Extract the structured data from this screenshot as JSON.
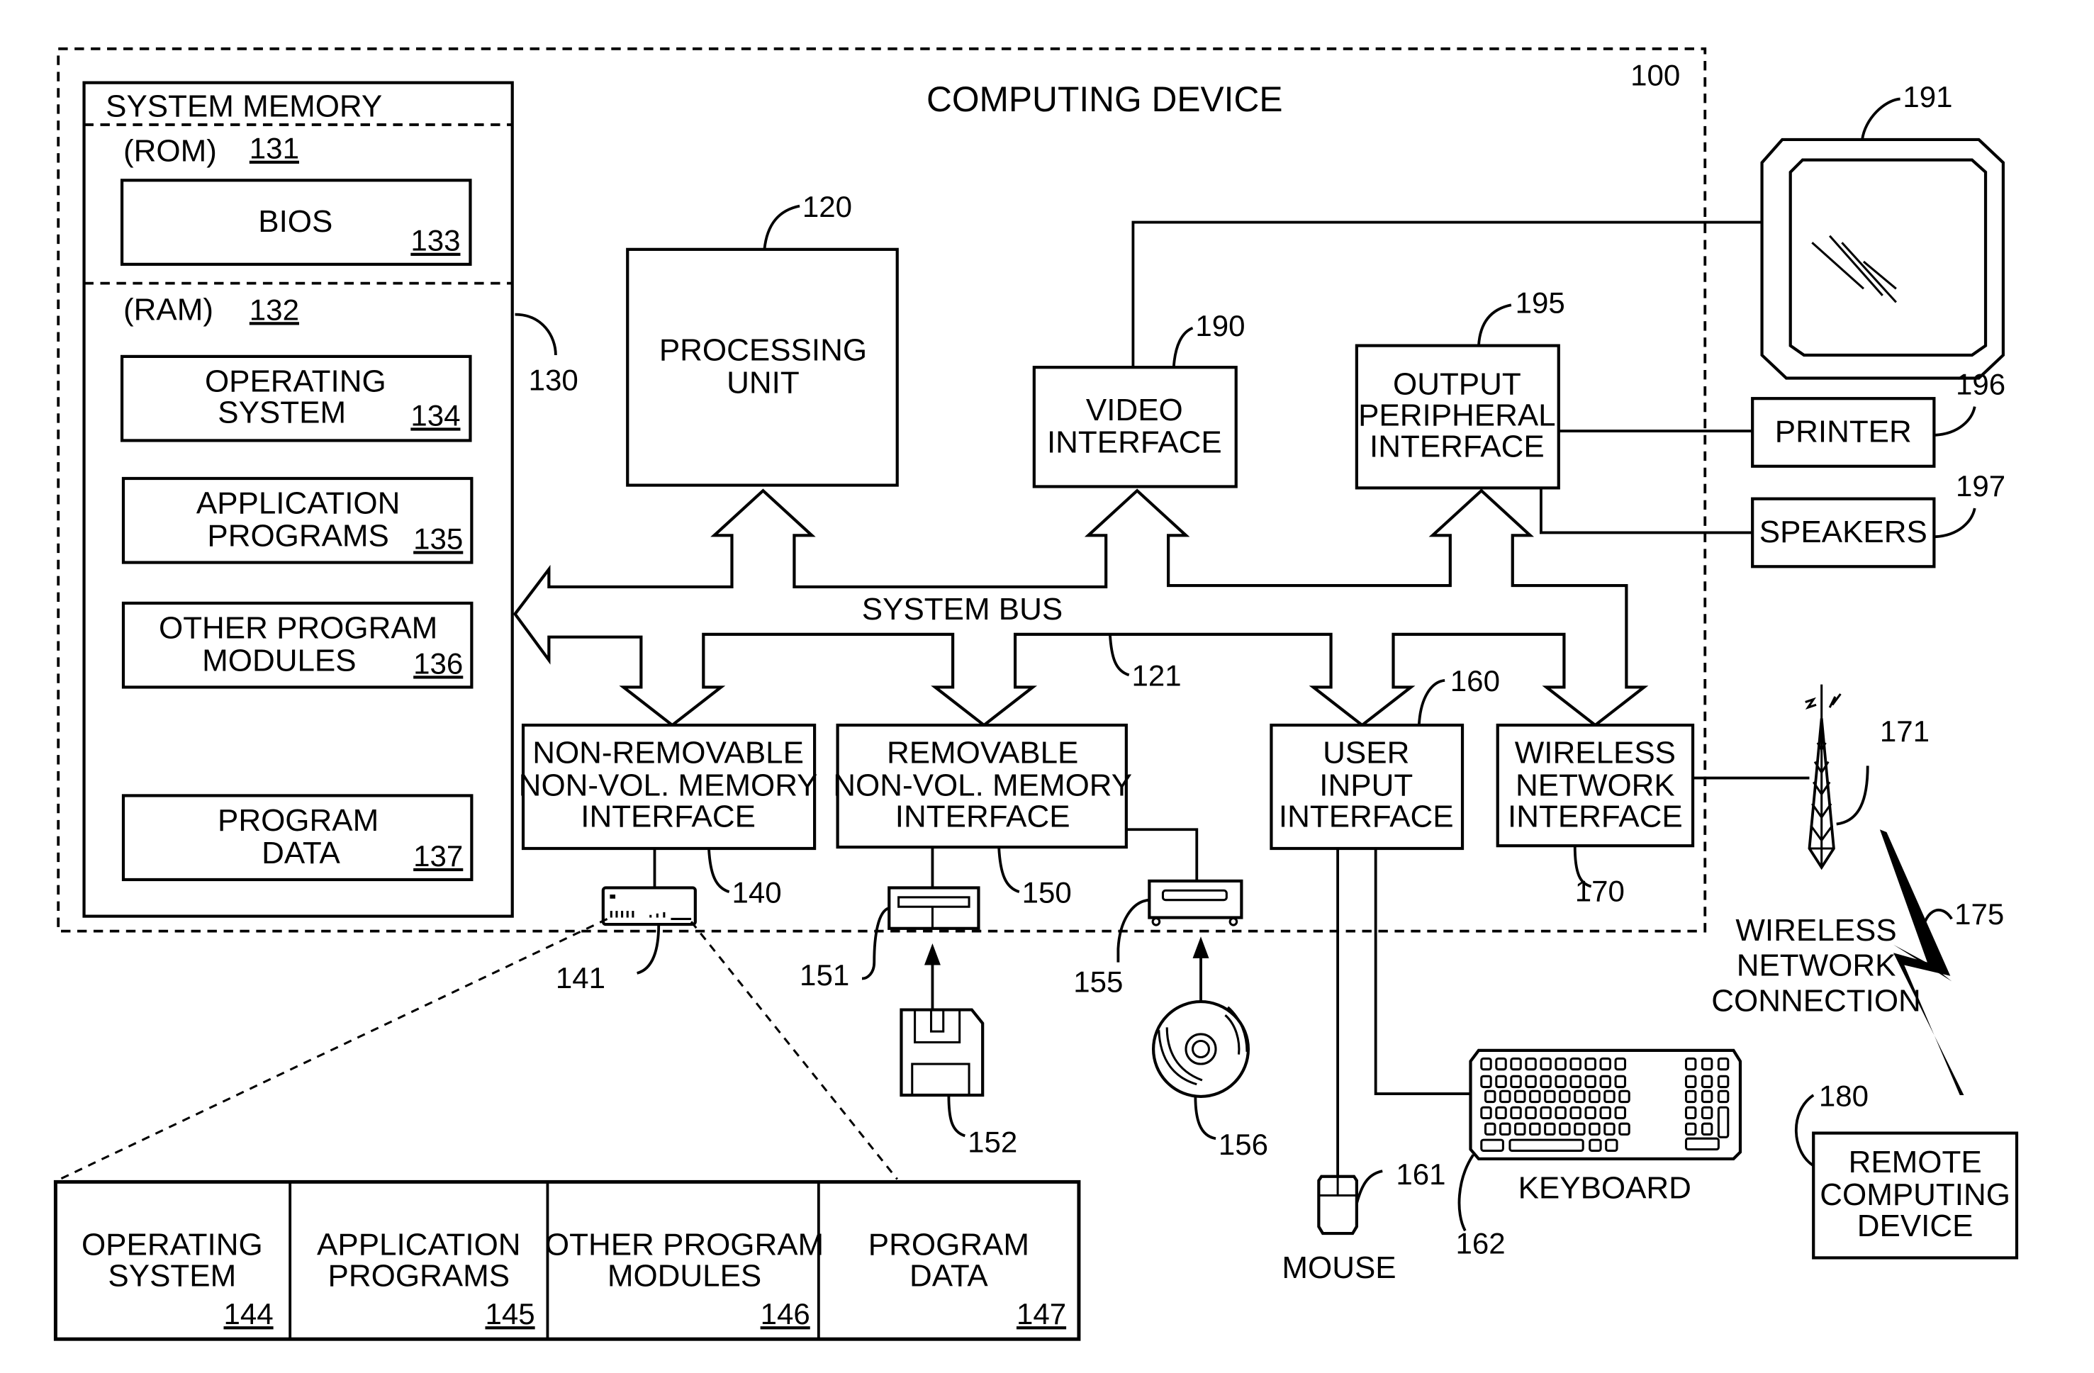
{
  "diagram": {
    "title": "COMPUTING DEVICE",
    "ref": "100",
    "system_memory": {
      "label": "SYSTEM MEMORY",
      "ref": "130",
      "rom": {
        "label": "(ROM)",
        "ref": "131"
      },
      "bios": {
        "label": "BIOS",
        "ref": "133"
      },
      "ram": {
        "label": "(RAM)",
        "ref": "132"
      },
      "items": [
        {
          "line1": "OPERATING",
          "line2": "SYSTEM",
          "ref": "134"
        },
        {
          "line1": "APPLICATION",
          "line2": "PROGRAMS",
          "ref": "135"
        },
        {
          "line1": "OTHER PROGRAM",
          "line2": "MODULES",
          "ref": "136"
        },
        {
          "line1": "PROGRAM",
          "line2": "DATA",
          "ref": "137"
        }
      ]
    },
    "processing_unit": {
      "line1": "PROCESSING",
      "line2": "UNIT",
      "ref": "120"
    },
    "video_interface": {
      "line1": "VIDEO",
      "line2": "INTERFACE",
      "ref": "190"
    },
    "output_peripheral_interface": {
      "line1": "OUTPUT",
      "line2": "PERIPHERAL",
      "line3": "INTERFACE",
      "ref": "195"
    },
    "monitor": {
      "ref": "191"
    },
    "printer": {
      "label": "PRINTER",
      "ref": "196"
    },
    "speakers": {
      "label": "SPEAKERS",
      "ref": "197"
    },
    "system_bus": {
      "label": "SYSTEM BUS",
      "ref": "121"
    },
    "non_removable_interface": {
      "line1": "NON-REMOVABLE",
      "line2": "NON-VOL. MEMORY",
      "line3": "INTERFACE",
      "ref": "140"
    },
    "removable_interface": {
      "line1": "REMOVABLE",
      "line2": "NON-VOL. MEMORY",
      "line3": "INTERFACE",
      "ref": "150"
    },
    "user_input_interface": {
      "line1": "USER",
      "line2": "INPUT",
      "line3": "INTERFACE",
      "ref": "160"
    },
    "wireless_network_interface": {
      "line1": "WIRELESS",
      "line2": "NETWORK",
      "line3": "INTERFACE",
      "ref": "170"
    },
    "hard_disk": {
      "ref": "141"
    },
    "floppy_drive": {
      "ref": "151"
    },
    "floppy_disk": {
      "ref": "152"
    },
    "optical_drive": {
      "ref": "155"
    },
    "optical_disk": {
      "ref": "156"
    },
    "antenna": {
      "ref": "171"
    },
    "wireless_connection": {
      "line1": "WIRELESS",
      "line2": "NETWORK",
      "line3": "CONNECTION",
      "ref": "175"
    },
    "remote_device": {
      "line1": "REMOTE",
      "line2": "COMPUTING",
      "line3": "DEVICE",
      "ref": "180"
    },
    "mouse": {
      "label": "MOUSE",
      "ref": "161"
    },
    "keyboard": {
      "label": "KEYBOARD",
      "ref": "162"
    },
    "disk_contents": [
      {
        "line1": "OPERATING",
        "line2": "SYSTEM",
        "ref": "144"
      },
      {
        "line1": "APPLICATION",
        "line2": "PROGRAMS",
        "ref": "145"
      },
      {
        "line1": "OTHER PROGRAM",
        "line2": "MODULES",
        "ref": "146"
      },
      {
        "line1": "PROGRAM",
        "line2": "DATA",
        "ref": "147"
      }
    ]
  }
}
